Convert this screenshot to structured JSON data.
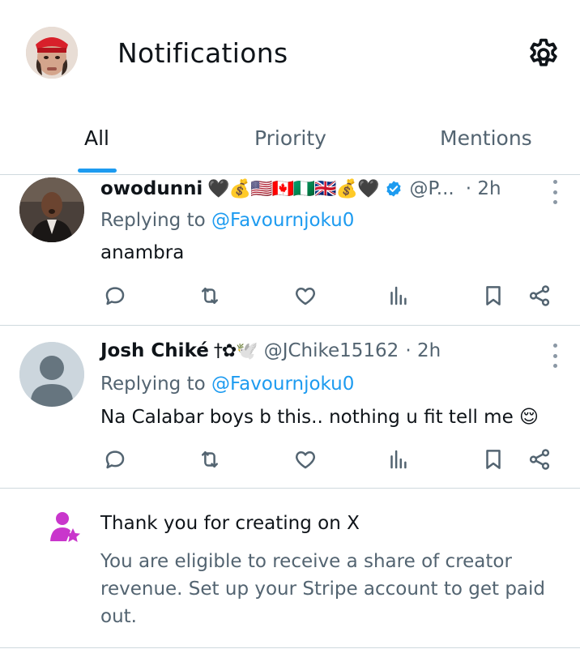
{
  "header": {
    "title": "Notifications",
    "avatar_icon": "profile-avatar",
    "settings_icon": "gear-icon"
  },
  "tabs": [
    {
      "label": "All",
      "active": true
    },
    {
      "label": "Priority",
      "active": false
    },
    {
      "label": "Mentions",
      "active": false
    }
  ],
  "accent_color": "#1d9bf0",
  "tweets": [
    {
      "name": "owodunni",
      "name_emoji": "🖤💰🇺🇸🇨🇦🇳🇬🇬🇧💰🖤",
      "verified": true,
      "handle": "@P...",
      "time": "· 2h",
      "reply_prefix": "Replying to",
      "reply_to": "@Favournjoku0",
      "text": "anambra"
    },
    {
      "name": "Josh Chiké",
      "name_emoji": "†✿🕊️",
      "verified": false,
      "handle": "@JChike15162",
      "time": "· 2h",
      "reply_prefix": "Replying to",
      "reply_to": "@Favournjoku0",
      "text": "Na Calabar boys b this.. nothing u fit tell me 😌"
    }
  ],
  "creator_notice": {
    "icon": "creator-star-icon",
    "title": "Thank you for creating on X",
    "description": "You are eligible to receive a share of creator revenue. Set up your Stripe account to get paid out.",
    "icon_color": "#c936cc"
  }
}
